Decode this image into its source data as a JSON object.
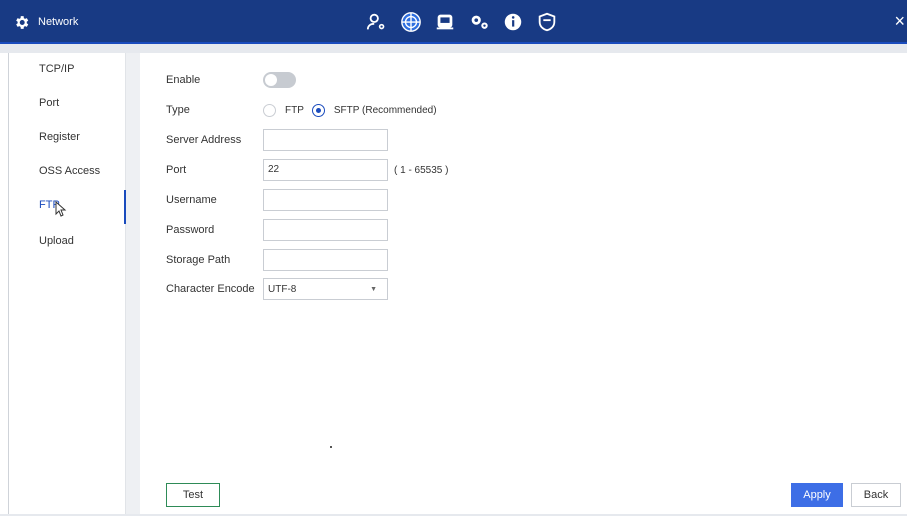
{
  "header": {
    "title": "Network",
    "close_glyph": "×",
    "nav_icons": [
      "user-settings-icon",
      "network-globe-icon",
      "storage-icon",
      "system-settings-icon",
      "info-icon",
      "security-shield-icon"
    ]
  },
  "sidebar": {
    "items": [
      {
        "label": "TCP/IP"
      },
      {
        "label": "Port"
      },
      {
        "label": "Register"
      },
      {
        "label": "OSS Access"
      },
      {
        "label": "FTP"
      },
      {
        "label": "Upload"
      }
    ],
    "active": "FTP"
  },
  "form": {
    "enable_label": "Enable",
    "enable_state": "off",
    "type_label": "Type",
    "type_options": [
      "FTP",
      "SFTP (Recommended)"
    ],
    "type_selected": "SFTP (Recommended)",
    "server_address_label": "Server Address",
    "server_address_value": "",
    "port_label": "Port",
    "port_value": "22",
    "port_hint": "( 1 - 65535 )",
    "username_label": "Username",
    "username_value": "",
    "password_label": "Password",
    "password_value": "",
    "storage_path_label": "Storage Path",
    "storage_path_value": "",
    "character_encode_label": "Character Encode",
    "character_encode_value": "UTF-8"
  },
  "buttons": {
    "test": "Test",
    "apply": "Apply",
    "back": "Back"
  },
  "colors": {
    "header_bg": "#183a84",
    "accent": "#1a4bbd",
    "apply_bg": "#3d6ee6",
    "test_border": "#2e8b57"
  }
}
